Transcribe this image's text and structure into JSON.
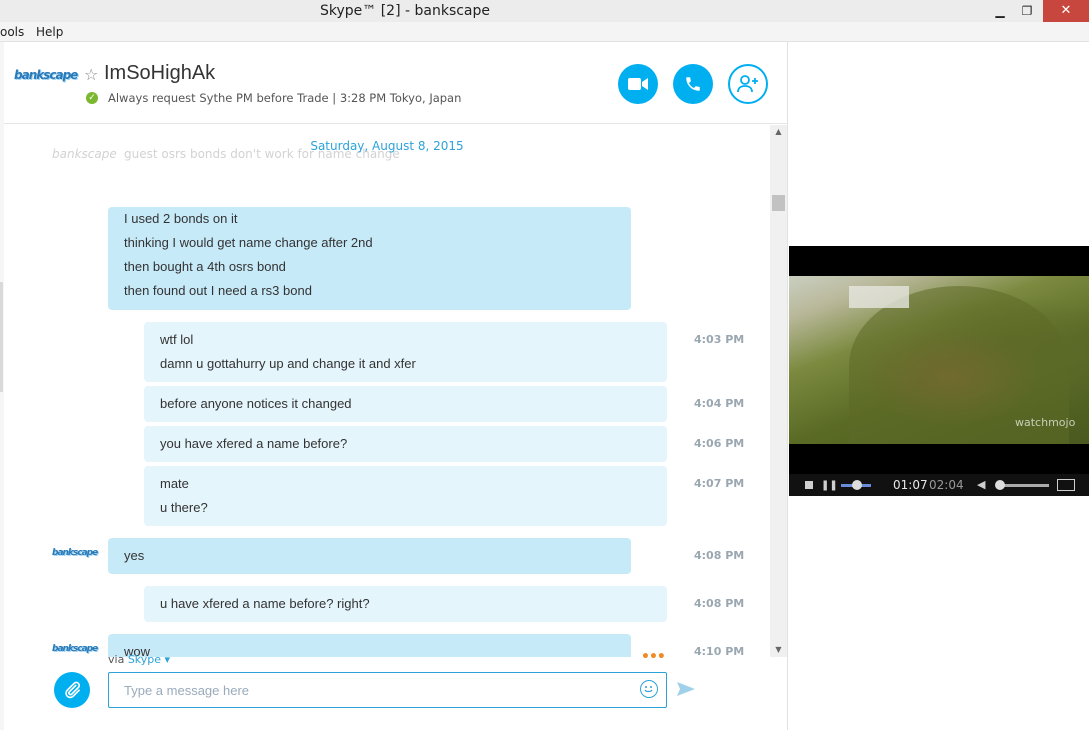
{
  "window": {
    "title": "Skype™ [2] - bankscape",
    "minimize_glyph": "▁",
    "restore_glyph": "❐",
    "close_glyph": "✕"
  },
  "menu": {
    "items": [
      "ools",
      "Help"
    ]
  },
  "contact": {
    "avatar_text": "bankscape",
    "name": "ImSoHighAk",
    "mood": "Always request Sythe PM before Trade  |  3:28 PM Tokyo, Japan",
    "status": "online"
  },
  "conversation": {
    "date": "Saturday, August 8, 2015",
    "ghost_line": "guest osrs bonds don't work for name change",
    "messages": [
      {
        "lines": [
          "I used 2 bonds on it",
          "thinking I would get name change after 2nd",
          "then bought a 4th osrs bond",
          "then found out I need a rs3 bond"
        ],
        "time": ""
      },
      {
        "lines": [
          "wtf lol",
          "damn u gottahurry up and change it and xfer"
        ],
        "time": "4:03 PM"
      },
      {
        "lines": [
          "before anyone notices it changed"
        ],
        "time": "4:04 PM"
      },
      {
        "lines": [
          "you have xfered a name before?"
        ],
        "time": "4:06 PM"
      },
      {
        "lines": [
          "mate",
          "u there?"
        ],
        "time": "4:07 PM"
      },
      {
        "lines": [
          "yes"
        ],
        "time": "4:08 PM"
      },
      {
        "lines": [
          "u have xfered a name before? right?"
        ],
        "time": "4:08 PM"
      },
      {
        "lines": [
          "wow"
        ],
        "time": "4:10 PM"
      }
    ]
  },
  "compose": {
    "via_prefix": "via",
    "via_service": "Skype",
    "dropdown_glyph": "▾",
    "typing_glyph": "•••",
    "placeholder": "Type a message here"
  },
  "video": {
    "current_time": "01:07",
    "duration": "02:04",
    "watermark": "watchmojo",
    "progress": 0.54
  },
  "colors": {
    "accent": "#00aff0",
    "incoming_bubble": "#c7eaf9",
    "outgoing_bubble": "#e5f5fc",
    "link": "#2da2d8",
    "typing": "#f08a24",
    "close": "#c7463d"
  }
}
